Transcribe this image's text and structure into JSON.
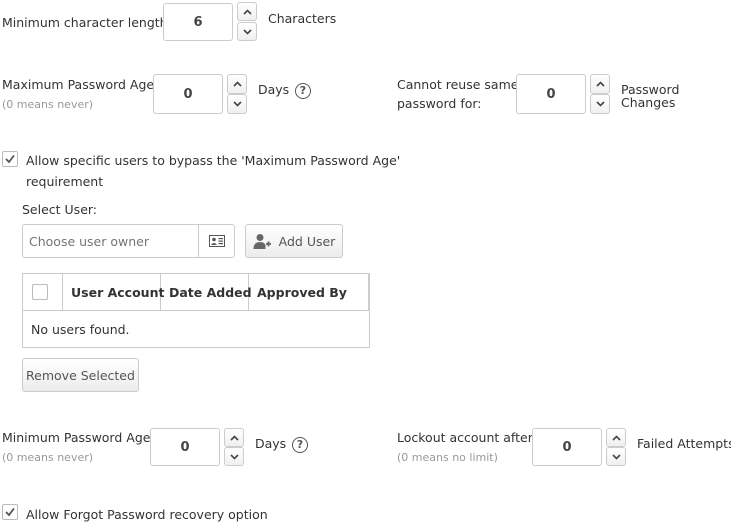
{
  "min_length": {
    "label": "Minimum character length:",
    "value": "6",
    "unit": "Characters"
  },
  "max_age": {
    "label": "Maximum Password Age:",
    "hint": "(0 means never)",
    "value": "0",
    "unit": "Days",
    "help_icon": "help-circle-icon"
  },
  "reuse": {
    "label_line1": "Cannot reuse same",
    "label_line2": "password for:",
    "value": "0",
    "unit_line1": "Password",
    "unit_line2": "Changes"
  },
  "bypass": {
    "checked": true,
    "label_line1": "Allow specific users to bypass the 'Maximum Password Age'",
    "label_line2": "requirement"
  },
  "select_user": {
    "label": "Select User:",
    "placeholder": "Choose user owner",
    "card_icon": "contact-card-icon",
    "add_button": "Add User",
    "add_icon": "add-user-icon"
  },
  "users_table": {
    "columns": [
      "User Account",
      "Date Added",
      "Approved By"
    ],
    "empty_text": "No users found."
  },
  "remove_button": "Remove Selected",
  "min_age": {
    "label": "Minimum Password Age:",
    "hint": "(0 means never)",
    "value": "0",
    "unit": "Days",
    "help_icon": "help-circle-icon"
  },
  "lockout": {
    "label": "Lockout account after:",
    "hint": "(0 means no limit)",
    "value": "0",
    "unit": "Failed Attempts"
  },
  "forgot": {
    "checked": true,
    "label": "Allow Forgot Password recovery option"
  }
}
